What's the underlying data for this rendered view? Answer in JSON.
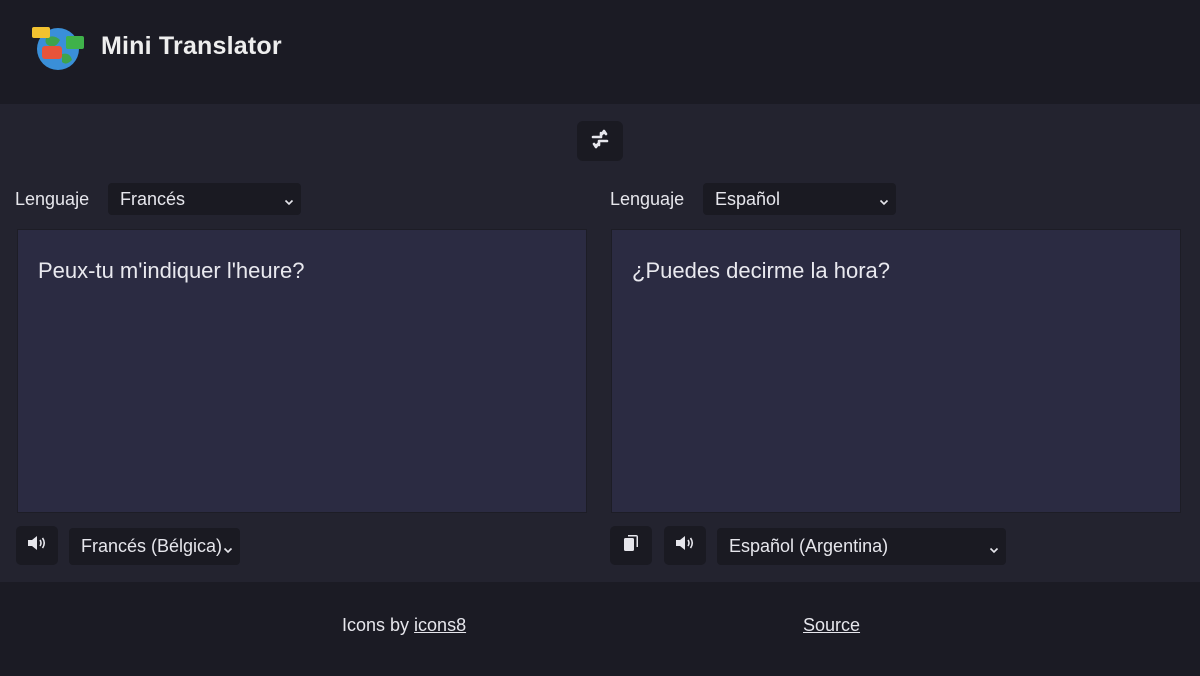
{
  "header": {
    "title": "Mini Translator",
    "logo_icon": "globe-chat-icon"
  },
  "toolbar": {
    "swap_icon": "swap-arrows-icon"
  },
  "source": {
    "language_label": "Lenguaje",
    "language_selected": "Francés",
    "text": "Peux-tu m'indiquer l'heure?",
    "speak_icon": "speaker-icon",
    "voice_selected": "Francés (Bélgica)"
  },
  "target": {
    "language_label": "Lenguaje",
    "language_selected": "Español",
    "text": "¿Puedes decirme la hora?",
    "copy_icon": "copy-icon",
    "speak_icon": "speaker-icon",
    "voice_selected": "Español (Argentina)"
  },
  "footer": {
    "credits_prefix": "Icons by ",
    "credits_link": "icons8",
    "source_link": "Source"
  },
  "colors": {
    "header_bg": "#1b1b24",
    "main_bg": "#23232f",
    "pane_bg": "#2b2b42",
    "control_bg": "#1a1a22",
    "text": "#e6e6ec"
  }
}
